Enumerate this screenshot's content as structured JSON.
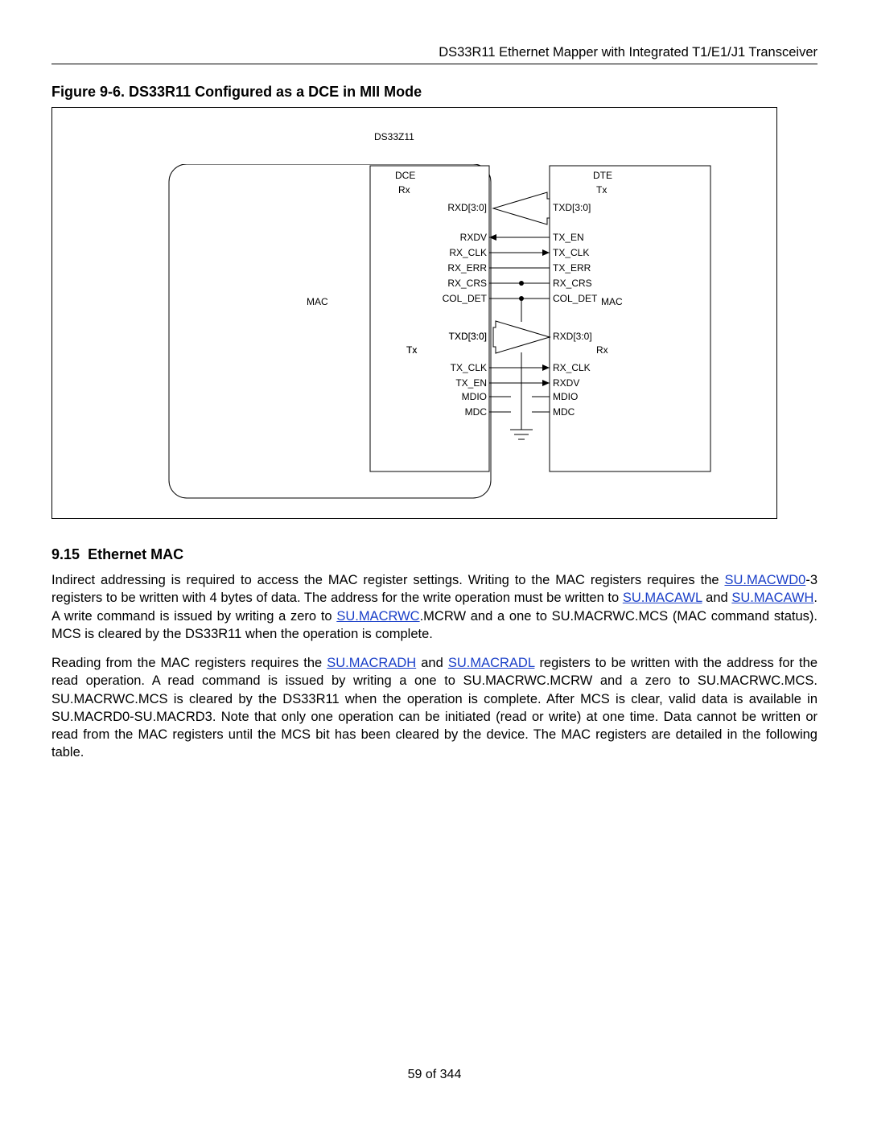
{
  "header": {
    "title": "DS33R11 Ethernet Mapper with Integrated T1/E1/J1 Transceiver"
  },
  "figure": {
    "caption": "Figure 9-6. DS33R11 Configured as a DCE in MII Mode",
    "chip": "DS33Z11",
    "dce": {
      "title": "DCE",
      "rx": "Rx",
      "tx": "Tx",
      "mac": "MAC"
    },
    "dte": {
      "title": "DTE",
      "rx": "Rx",
      "tx": "Tx",
      "mac": "MAC"
    },
    "sig_left_rx": [
      "RXD[3:0]",
      "RXDV",
      "RX_CLK",
      "RX_ERR",
      "RX_CRS",
      "COL_DET"
    ],
    "sig_right_tx": [
      "TXD[3:0]",
      "TX_EN",
      "TX_CLK",
      "TX_ERR",
      "RX_CRS",
      "COL_DET"
    ],
    "sig_left_tx": [
      "TXD[3:0]",
      "TX_CLK",
      "TX_EN",
      "MDIO",
      "MDC"
    ],
    "sig_right_rx": [
      "RXD[3:0]",
      "RX_CLK",
      "RXDV",
      "MDIO",
      "MDC"
    ]
  },
  "section": {
    "num": "9.15",
    "title": "Ethernet MAC"
  },
  "p1": {
    "t1": "Indirect addressing is required to access the MAC register settings. Writing to the MAC registers requires the ",
    "l1": "SU.MACWD0",
    "t2": "-3 registers to be written with 4 bytes of data. The address for the write operation must be written to ",
    "l2": "SU.MACAWL",
    "t3": " and ",
    "l3": "SU.MACAWH",
    "t4": ". A write command is issued by writing a zero to ",
    "l4": "SU.MACRWC",
    "t5": ".MCRW and a one to SU.MACRWC.MCS (MAC command status). MCS is cleared by the DS33R11 when the operation is complete."
  },
  "p2": {
    "t1": "Reading from the MAC registers requires the ",
    "l1": "SU.MACRADH",
    "t2": " and ",
    "l2": "SU.MACRADL",
    "t3": " registers to be written with the address for the read operation. A read command is issued by writing a one to SU.MACRWC.MCRW and a zero to SU.MACRWC.MCS. SU.MACRWC.MCS is cleared by the DS33R11 when the operation is complete. After MCS is clear, valid data is available in SU.MACRD0-SU.MACRD3. Note that only one operation can be initiated (read or write) at one time. Data cannot be written or read from the MAC registers until the MCS bit has been cleared by the device. The MAC registers are detailed in the following table."
  },
  "footer": {
    "page": "59 of 344"
  }
}
